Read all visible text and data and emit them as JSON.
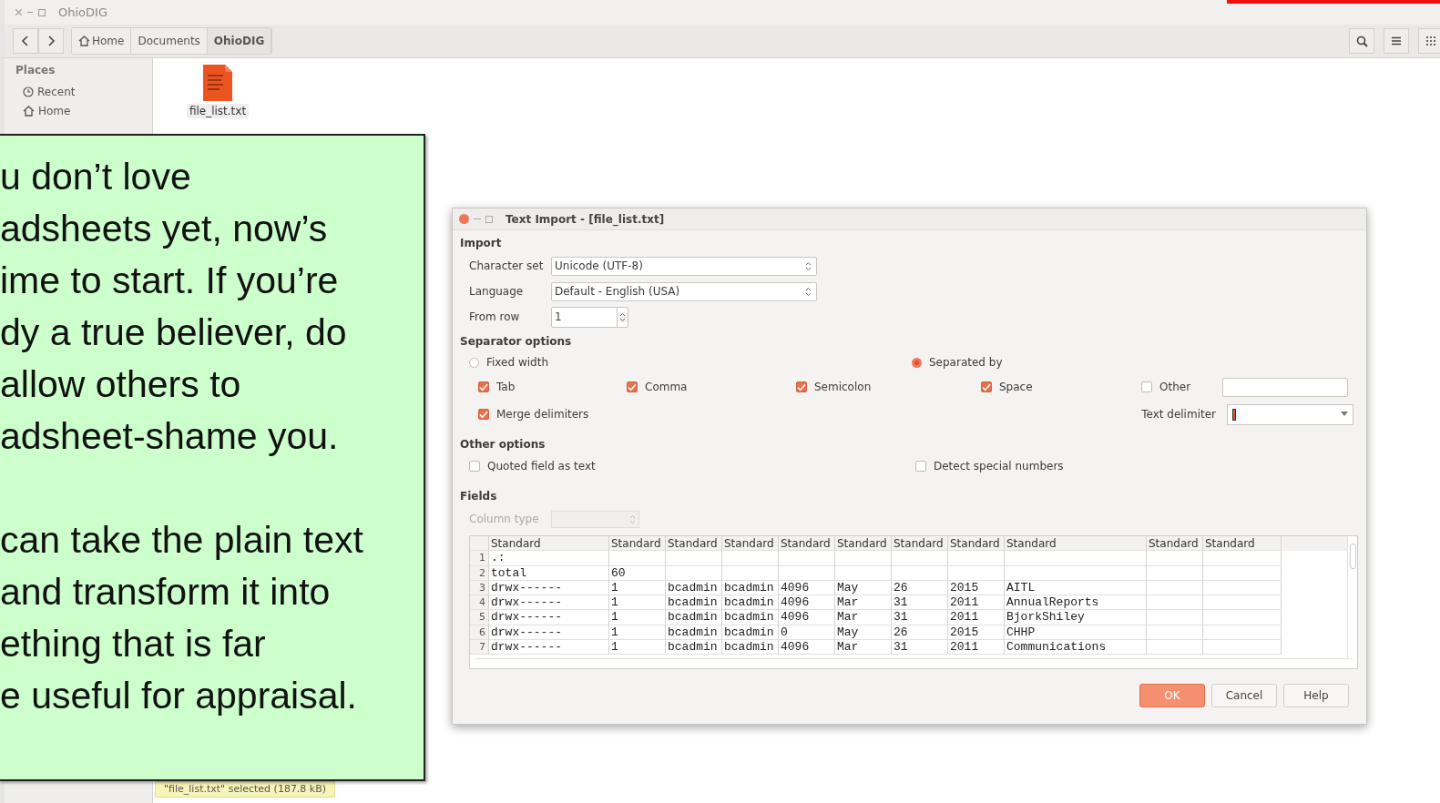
{
  "file_manager": {
    "window": {
      "title": "OhioDIG"
    },
    "breadcrumbs": [
      {
        "label": "Home",
        "kind": "home",
        "selected": false
      },
      {
        "label": "Documents",
        "kind": "plain",
        "selected": false
      },
      {
        "label": "OhioDIG",
        "kind": "plain",
        "selected": true
      }
    ],
    "sidebar": {
      "heading": "Places",
      "items": [
        {
          "label": "Recent",
          "kind": "recent"
        },
        {
          "label": "Home",
          "kind": "home"
        }
      ]
    },
    "files": [
      {
        "name": "file_list.txt",
        "selected": true
      }
    ],
    "status": "\"file_list.txt\" selected  (187.8 kB)"
  },
  "callout": {
    "paragraphs": [
      [
        "u don’t love",
        "adsheets yet, now’s",
        "ime to start. If you’re",
        "dy a true believer, do",
        "allow others to",
        "adsheet-shame you."
      ],
      [
        "can take the plain text",
        "and transform it into",
        "ething that is far",
        "e useful for appraisal."
      ]
    ]
  },
  "dialog": {
    "title": "Text Import - [file_list.txt]",
    "import": {
      "heading": "Import",
      "fields": [
        {
          "label": "Character set",
          "value": "Unicode (UTF-8)",
          "kind": "combo"
        },
        {
          "label": "Language",
          "value": "Default - English (USA)",
          "kind": "combo"
        },
        {
          "label": "From row",
          "value": "1",
          "kind": "spin"
        }
      ]
    },
    "separator_options": {
      "heading": "Separator options",
      "modes": [
        {
          "label": "Fixed width",
          "selected": false
        },
        {
          "label": "Separated by",
          "selected": true
        }
      ],
      "separators": [
        {
          "label": "Tab",
          "checked": true
        },
        {
          "label": "Comma",
          "checked": true
        },
        {
          "label": "Semicolon",
          "checked": true
        },
        {
          "label": "Space",
          "checked": true
        },
        {
          "label": "Other",
          "checked": false
        }
      ],
      "merge": {
        "label": "Merge delimiters",
        "checked": true
      },
      "text_delimiter": {
        "label": "Text delimiter"
      }
    },
    "other_options": {
      "heading": "Other options",
      "options": [
        {
          "label": "Quoted field as text",
          "checked": false
        },
        {
          "label": "Detect special numbers",
          "checked": false
        }
      ]
    },
    "fields": {
      "heading": "Fields",
      "column_type": {
        "label": "Column type",
        "disabled": true
      },
      "table": {
        "columns": [
          "Standard",
          "Standard",
          "Standard",
          "Standard",
          "Standard",
          "Standard",
          "Standard",
          "Standard",
          "Standard",
          "Standard",
          "Standard"
        ],
        "rows": [
          {
            "number": "1",
            "cells": [
              ".:",
              "",
              "",
              "",
              "",
              "",
              "",
              "",
              "",
              "",
              ""
            ]
          },
          {
            "number": "2",
            "cells": [
              "total",
              "60",
              "",
              "",
              "",
              "",
              "",
              "",
              "",
              "",
              ""
            ]
          },
          {
            "number": "3",
            "cells": [
              "drwx------",
              "1",
              "bcadmin",
              "bcadmin",
              "4096",
              "May",
              "26",
              "2015",
              "AITL",
              "",
              ""
            ]
          },
          {
            "number": "4",
            "cells": [
              "drwx------",
              "1",
              "bcadmin",
              "bcadmin",
              "4096",
              "Mar",
              "31",
              "2011",
              "AnnualReports",
              "",
              ""
            ]
          },
          {
            "number": "5",
            "cells": [
              "drwx------",
              "1",
              "bcadmin",
              "bcadmin",
              "4096",
              "Mar",
              "31",
              "2011",
              "BjorkShiley",
              "",
              ""
            ]
          },
          {
            "number": "6",
            "cells": [
              "drwx------",
              "1",
              "bcadmin",
              "bcadmin",
              "0",
              "May",
              "26",
              "2015",
              "CHHP",
              "",
              ""
            ]
          },
          {
            "number": "7",
            "cells": [
              "drwx------",
              "1",
              "bcadmin",
              "bcadmin",
              "4096",
              "Mar",
              "31",
              "2011",
              "Communications",
              "",
              ""
            ]
          }
        ]
      }
    },
    "buttons": [
      {
        "label": "OK",
        "kind": "primary"
      },
      {
        "label": "Cancel",
        "kind": "normal"
      },
      {
        "label": "Help",
        "kind": "normal"
      }
    ]
  }
}
